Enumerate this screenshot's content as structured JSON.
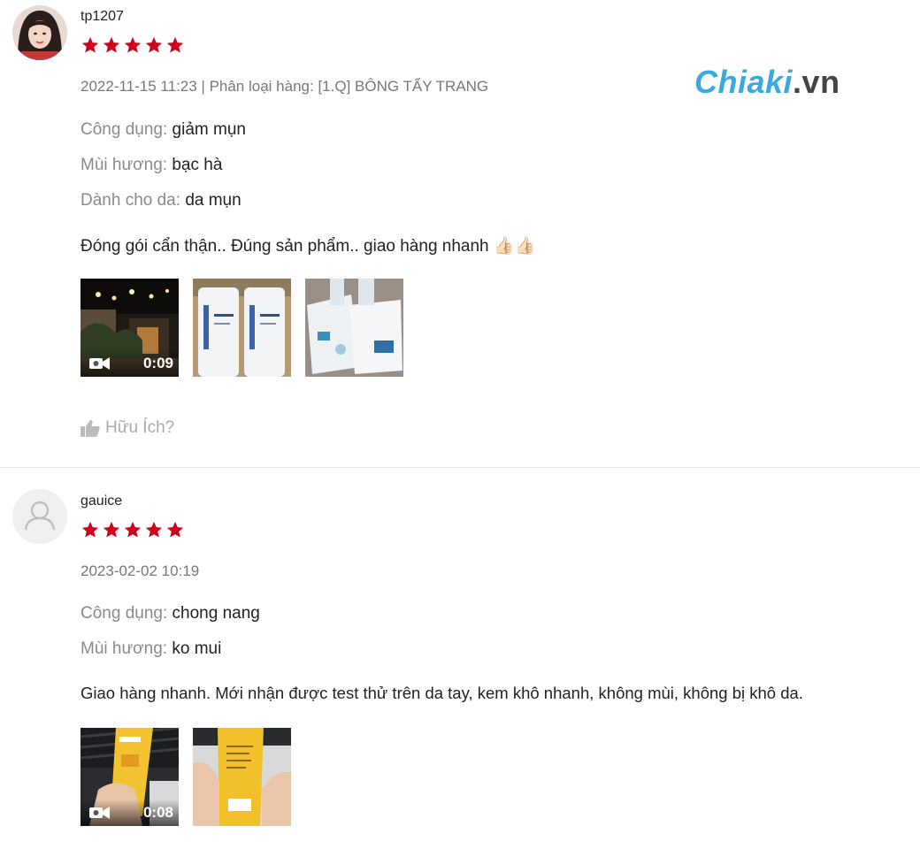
{
  "brand": {
    "name": "Chiaki",
    "suffix": ".vn"
  },
  "reviews": [
    {
      "username": "tp1207",
      "rating": 5,
      "meta": "2022-11-15 11:23 | Phân loại hàng: [1.Q] BÔNG TẨY TRANG",
      "attributes": [
        {
          "key": "Công dụng:",
          "value": "giảm mụn"
        },
        {
          "key": "Mùi hương:",
          "value": "bạc hà"
        },
        {
          "key": "Dành cho da:",
          "value": "da mụn"
        }
      ],
      "comment": "Đóng gói cẩn thận.. Đúng sản phẩm.. giao hàng nhanh 👍🏻👍🏻",
      "media": [
        {
          "kind": "video",
          "duration": "0:09"
        },
        {
          "kind": "image"
        },
        {
          "kind": "image"
        }
      ],
      "helpful_label": "Hữu Ích?"
    },
    {
      "username": "gauice",
      "rating": 5,
      "meta": "2023-02-02 10:19",
      "attributes": [
        {
          "key": "Công dụng:",
          "value": "chong nang"
        },
        {
          "key": "Mùi hương:",
          "value": "ko mui"
        }
      ],
      "comment": "Giao hàng nhanh. Mới nhận được test thử trên da tay, kem khô nhanh, không mùi, không bị khô da.",
      "media": [
        {
          "kind": "video",
          "duration": "0:08"
        },
        {
          "kind": "image"
        }
      ]
    }
  ],
  "colors": {
    "star": "#d0011b",
    "brand_blue": "#39a9e0",
    "muted": "#8a8a8a"
  }
}
